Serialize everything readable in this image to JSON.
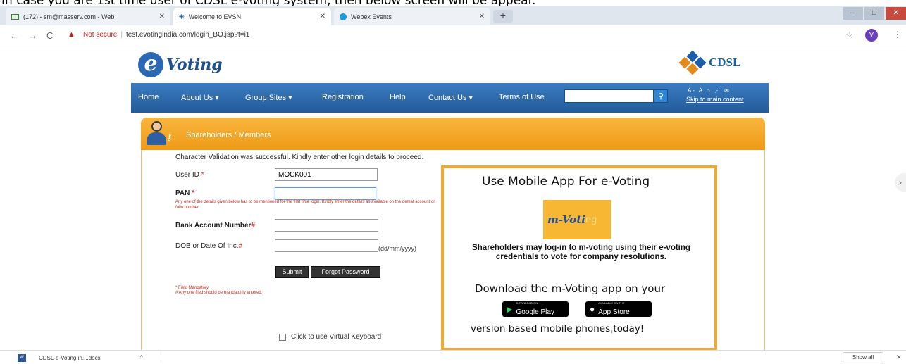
{
  "caption": "In case you are 1st time user of CDSL e-voting system, then below screen will be appear.",
  "browser": {
    "tabs": [
      {
        "label": "(172) - sm@masserv.com - Web",
        "icon": "mail-icon"
      },
      {
        "label": "Welcome to EVSN",
        "icon": "site-icon"
      },
      {
        "label": "Webex Events",
        "icon": "webex-icon"
      }
    ],
    "new_tab": "+",
    "not_secure": "Not secure",
    "url": "test.evotingindia.com/login_BO.jsp?t=i1",
    "profile_initial": "V"
  },
  "header": {
    "evoting_letter": "e",
    "evoting_word": "Voting",
    "cdsl": "CDSL"
  },
  "nav": {
    "items": [
      "Home",
      "About Us ▾",
      "Group Sites ▾",
      "Registration",
      "Help",
      "Contact Us ▾",
      "Terms of Use"
    ],
    "tools": "A- A  ⌂  ⋰  ✉",
    "skip": "Skip to main content"
  },
  "panel": {
    "title": "Shareholders / Members",
    "message": "Character Validation was successful. Kindly enter other login details to proceed.",
    "user_id_label": "User ID",
    "user_id_value": "MOCK001",
    "pan_label": "PAN",
    "pan_note": "Any one of the details given below has to be mentioned for the first time login. Kindly enter the details as available on the demat account or folio number.",
    "bank_label": "Bank Account Number",
    "dob_label": "DOB or Date Of Inc.",
    "dob_format": "(dd/mm/yyyy)",
    "submit": "Submit",
    "forgot": "Forgot Password",
    "note1": "* Field Mandatory.",
    "note2": "# Any one filed should be mandatorily entered.",
    "virtual_kb": "Click to use Virtual Keyboard"
  },
  "app_box": {
    "title": "Use Mobile App For e-Voting",
    "logo_text": "m-Voti",
    "logo_suffix": "ng",
    "description": "Shareholders may log-in to m-voting using their e-voting credentials to vote for company resolutions.",
    "download_text": "Download the m-Voting app on your",
    "google_small": "DOWNLOAD ON",
    "google_big": "Google Play",
    "apple_small": "AVAILABLE ON THE",
    "apple_big": "App Store",
    "version_text": "version based mobile phones,today!"
  },
  "download_bar": {
    "file": "CDSL-e-Voting in....docx",
    "show_all": "Show all"
  }
}
